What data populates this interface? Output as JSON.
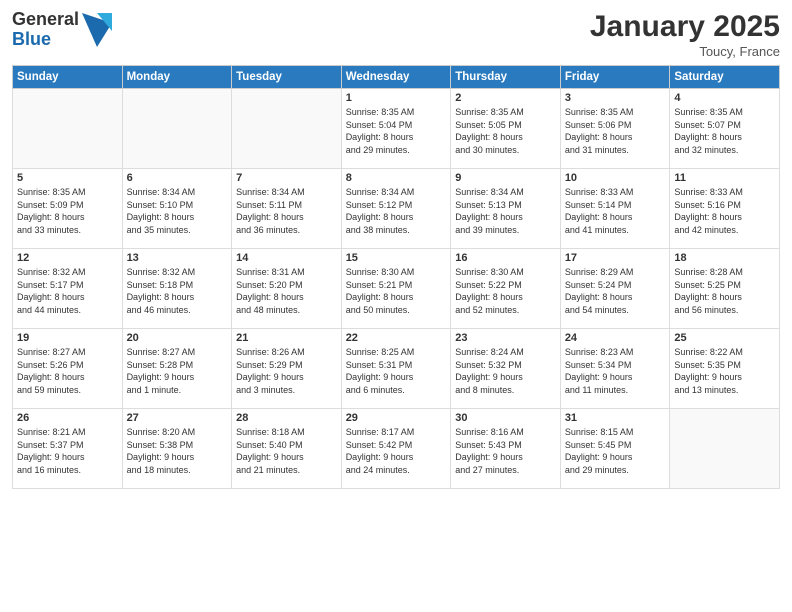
{
  "logo": {
    "general": "General",
    "blue": "Blue"
  },
  "title": "January 2025",
  "location": "Toucy, France",
  "days_of_week": [
    "Sunday",
    "Monday",
    "Tuesday",
    "Wednesday",
    "Thursday",
    "Friday",
    "Saturday"
  ],
  "weeks": [
    [
      {
        "num": "",
        "info": ""
      },
      {
        "num": "",
        "info": ""
      },
      {
        "num": "",
        "info": ""
      },
      {
        "num": "1",
        "info": "Sunrise: 8:35 AM\nSunset: 5:04 PM\nDaylight: 8 hours\nand 29 minutes."
      },
      {
        "num": "2",
        "info": "Sunrise: 8:35 AM\nSunset: 5:05 PM\nDaylight: 8 hours\nand 30 minutes."
      },
      {
        "num": "3",
        "info": "Sunrise: 8:35 AM\nSunset: 5:06 PM\nDaylight: 8 hours\nand 31 minutes."
      },
      {
        "num": "4",
        "info": "Sunrise: 8:35 AM\nSunset: 5:07 PM\nDaylight: 8 hours\nand 32 minutes."
      }
    ],
    [
      {
        "num": "5",
        "info": "Sunrise: 8:35 AM\nSunset: 5:09 PM\nDaylight: 8 hours\nand 33 minutes."
      },
      {
        "num": "6",
        "info": "Sunrise: 8:34 AM\nSunset: 5:10 PM\nDaylight: 8 hours\nand 35 minutes."
      },
      {
        "num": "7",
        "info": "Sunrise: 8:34 AM\nSunset: 5:11 PM\nDaylight: 8 hours\nand 36 minutes."
      },
      {
        "num": "8",
        "info": "Sunrise: 8:34 AM\nSunset: 5:12 PM\nDaylight: 8 hours\nand 38 minutes."
      },
      {
        "num": "9",
        "info": "Sunrise: 8:34 AM\nSunset: 5:13 PM\nDaylight: 8 hours\nand 39 minutes."
      },
      {
        "num": "10",
        "info": "Sunrise: 8:33 AM\nSunset: 5:14 PM\nDaylight: 8 hours\nand 41 minutes."
      },
      {
        "num": "11",
        "info": "Sunrise: 8:33 AM\nSunset: 5:16 PM\nDaylight: 8 hours\nand 42 minutes."
      }
    ],
    [
      {
        "num": "12",
        "info": "Sunrise: 8:32 AM\nSunset: 5:17 PM\nDaylight: 8 hours\nand 44 minutes."
      },
      {
        "num": "13",
        "info": "Sunrise: 8:32 AM\nSunset: 5:18 PM\nDaylight: 8 hours\nand 46 minutes."
      },
      {
        "num": "14",
        "info": "Sunrise: 8:31 AM\nSunset: 5:20 PM\nDaylight: 8 hours\nand 48 minutes."
      },
      {
        "num": "15",
        "info": "Sunrise: 8:30 AM\nSunset: 5:21 PM\nDaylight: 8 hours\nand 50 minutes."
      },
      {
        "num": "16",
        "info": "Sunrise: 8:30 AM\nSunset: 5:22 PM\nDaylight: 8 hours\nand 52 minutes."
      },
      {
        "num": "17",
        "info": "Sunrise: 8:29 AM\nSunset: 5:24 PM\nDaylight: 8 hours\nand 54 minutes."
      },
      {
        "num": "18",
        "info": "Sunrise: 8:28 AM\nSunset: 5:25 PM\nDaylight: 8 hours\nand 56 minutes."
      }
    ],
    [
      {
        "num": "19",
        "info": "Sunrise: 8:27 AM\nSunset: 5:26 PM\nDaylight: 8 hours\nand 59 minutes."
      },
      {
        "num": "20",
        "info": "Sunrise: 8:27 AM\nSunset: 5:28 PM\nDaylight: 9 hours\nand 1 minute."
      },
      {
        "num": "21",
        "info": "Sunrise: 8:26 AM\nSunset: 5:29 PM\nDaylight: 9 hours\nand 3 minutes."
      },
      {
        "num": "22",
        "info": "Sunrise: 8:25 AM\nSunset: 5:31 PM\nDaylight: 9 hours\nand 6 minutes."
      },
      {
        "num": "23",
        "info": "Sunrise: 8:24 AM\nSunset: 5:32 PM\nDaylight: 9 hours\nand 8 minutes."
      },
      {
        "num": "24",
        "info": "Sunrise: 8:23 AM\nSunset: 5:34 PM\nDaylight: 9 hours\nand 11 minutes."
      },
      {
        "num": "25",
        "info": "Sunrise: 8:22 AM\nSunset: 5:35 PM\nDaylight: 9 hours\nand 13 minutes."
      }
    ],
    [
      {
        "num": "26",
        "info": "Sunrise: 8:21 AM\nSunset: 5:37 PM\nDaylight: 9 hours\nand 16 minutes."
      },
      {
        "num": "27",
        "info": "Sunrise: 8:20 AM\nSunset: 5:38 PM\nDaylight: 9 hours\nand 18 minutes."
      },
      {
        "num": "28",
        "info": "Sunrise: 8:18 AM\nSunset: 5:40 PM\nDaylight: 9 hours\nand 21 minutes."
      },
      {
        "num": "29",
        "info": "Sunrise: 8:17 AM\nSunset: 5:42 PM\nDaylight: 9 hours\nand 24 minutes."
      },
      {
        "num": "30",
        "info": "Sunrise: 8:16 AM\nSunset: 5:43 PM\nDaylight: 9 hours\nand 27 minutes."
      },
      {
        "num": "31",
        "info": "Sunrise: 8:15 AM\nSunset: 5:45 PM\nDaylight: 9 hours\nand 29 minutes."
      },
      {
        "num": "",
        "info": ""
      }
    ]
  ]
}
